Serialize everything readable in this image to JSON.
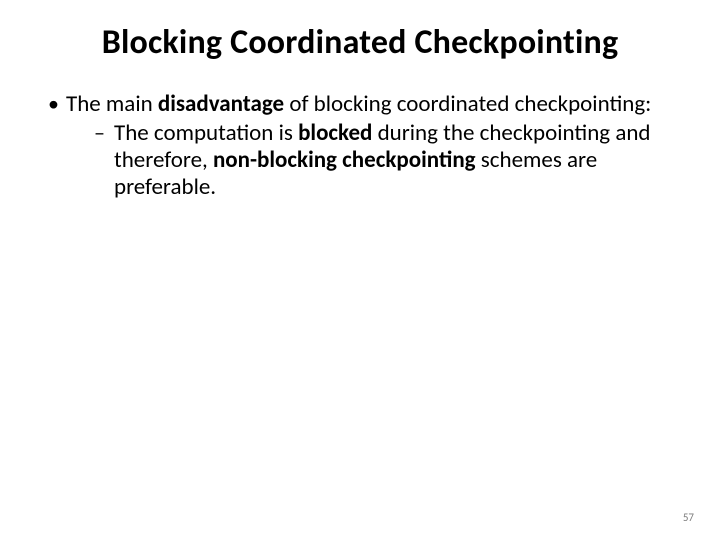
{
  "title": "Blocking Coordinated Checkpointing",
  "bullet1": {
    "pre": "The main ",
    "bold": "disadvantage",
    "post": " of blocking coordinated checkpointing:"
  },
  "sub1": {
    "s1": "The computation is ",
    "b1": "blocked",
    "s2": " during the checkpointing and therefore, ",
    "b2": "non-blocking checkpointing",
    "s3": " schemes are preferable."
  },
  "pageNumber": "57"
}
